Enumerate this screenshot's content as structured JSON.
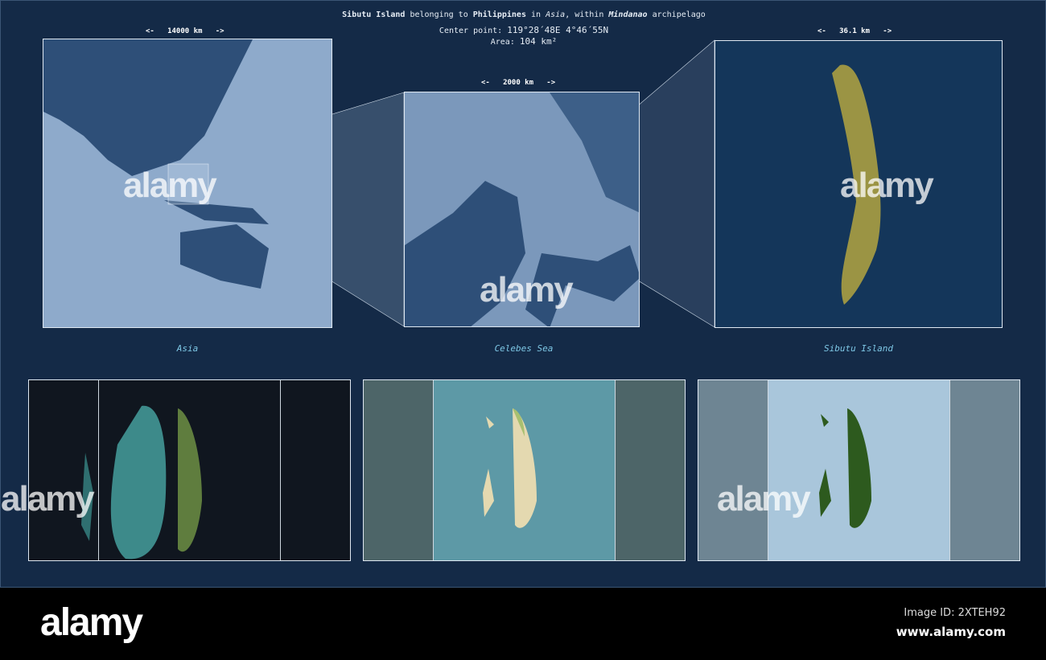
{
  "header": {
    "island": "Sibutu Island",
    "belonging": "belonging to",
    "country": "Philippines",
    "in": "in",
    "continent": "Asia",
    "within": ", within",
    "archipelago_name": "Mindanao",
    "archipelago": "archipelago",
    "center_label": "Center point:",
    "center_value": "119°28´48E  4°46´55N",
    "area_label": "Area:",
    "area_value": "104 km²"
  },
  "maps": [
    {
      "label": "Asia",
      "scale": "<-   14000 km   ->"
    },
    {
      "label": "Celebes Sea",
      "scale": "<-   2000 km   ->"
    },
    {
      "label": "Sibutu Island",
      "scale": "<-   36.1 km   ->"
    }
  ],
  "colors": {
    "panel": "#142a47",
    "island": "#9b9444",
    "land": "#2e4f78",
    "sea": "#8eaacb"
  },
  "watermark": "alamy",
  "footer": {
    "logo": "alamy",
    "image_id": "Image ID: 2XTEH92",
    "site": "www.alamy.com"
  }
}
